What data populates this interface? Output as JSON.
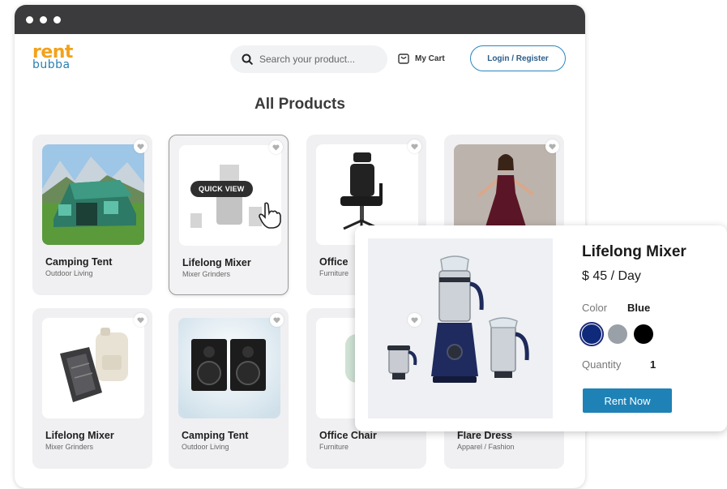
{
  "header": {
    "logo_top": "rent",
    "logo_bottom": "bubba",
    "search_placeholder": "Search your product...",
    "cart_label": "My Cart",
    "login_label": "Login / Register"
  },
  "page_title": "All Products",
  "products": [
    {
      "name": "Camping Tent",
      "category": "Outdoor Living"
    },
    {
      "name": "Lifelong Mixer",
      "category": "Mixer Grinders",
      "badge": "QUICK VIEW"
    },
    {
      "name": "Office",
      "category": "Furniture"
    },
    {
      "name": "",
      "category": ""
    },
    {
      "name": "Lifelong Mixer",
      "category": "Mixer Grinders"
    },
    {
      "name": "Camping Tent",
      "category": "Outdoor Living"
    },
    {
      "name": "Office Chair",
      "category": "Furniture"
    },
    {
      "name": "Flare Dress",
      "category": "Apparel / Fashion"
    }
  ],
  "quick_view": {
    "title": "Lifelong Mixer",
    "price": "$ 45 / Day",
    "color_label": "Color",
    "color_value": "Blue",
    "colors": [
      "#0f2a7a",
      "#9aa0a8",
      "#000000"
    ],
    "quantity_label": "Quantity",
    "quantity_value": "1",
    "button_label": "Rent Now"
  },
  "colors": {
    "accent": "#1f82b6",
    "logo_orange": "#f2a21a",
    "logo_blue": "#2a7fb2",
    "titlebar": "#3b3b3d"
  }
}
